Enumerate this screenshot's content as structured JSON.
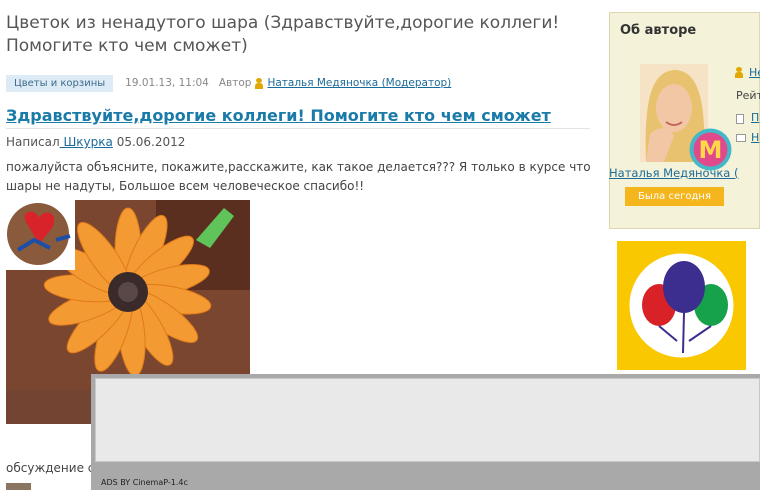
{
  "page": {
    "title": "Цветок из ненадутого шара (Здравствуйте,дорогие коллеги! Помогите кто чем сможет)"
  },
  "meta": {
    "category": "Цветы и корзины",
    "date": "19.01.13, 11:04",
    "author_label": "Автор",
    "author_link": "Наталья Медяночка (Модератор)"
  },
  "post": {
    "title": "Здравствуйте,дорогие коллеги! Помогите кто чем сможет",
    "byline_prefix": "Написал",
    "byline_author": " Шкурка",
    "byline_date": " 05.06.2012",
    "text": "пожалуйста объясните, покажите,расскажите, как такое делается??? Я только в курсе что шары не надуты, Большое всем человеческое спасибо!!",
    "discussion": "обсуждение с удовольствием"
  },
  "sidebar": {
    "box_title": "Об авторе",
    "link_1": "Не",
    "rating_label": "Рейт",
    "link_2": "П",
    "link_3": "Н",
    "author_name": "Наталья Медяночка (Мо",
    "badge_letter": "M",
    "last_seen": "Была сегодня"
  },
  "ad": {
    "label": "ADS BY CinemaP-1.4c"
  },
  "colors": {
    "link": "#1a6b9a",
    "accent_orange": "#f5b51c",
    "sidebar_bg": "#f5f2da",
    "logo_yellow": "#f9c800"
  }
}
